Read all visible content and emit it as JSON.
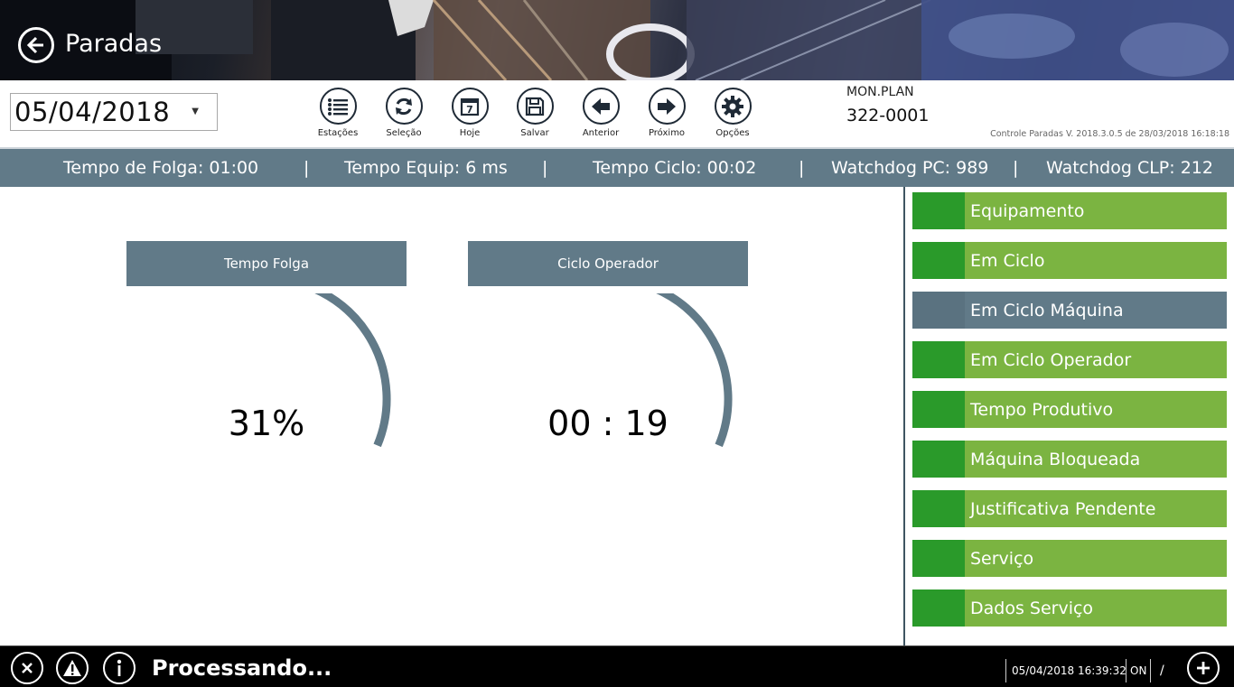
{
  "header": {
    "title": "Paradas",
    "back_icon": "arrow-left-icon"
  },
  "toolbar": {
    "date_value": "05/04/2018",
    "buttons": [
      {
        "label": "Estações",
        "icon": "list-icon"
      },
      {
        "label": "Seleção",
        "icon": "refresh-icon"
      },
      {
        "label": "Hoje",
        "icon": "calendar-icon"
      },
      {
        "label": "Salvar",
        "icon": "save-icon"
      },
      {
        "label": "Anterior",
        "icon": "arrow-left-icon"
      },
      {
        "label": "Próximo",
        "icon": "arrow-right-icon"
      },
      {
        "label": "Opções",
        "icon": "gear-icon"
      }
    ],
    "plan_label": "MON.PLAN",
    "plan_code": "322-0001",
    "version": "Controle Paradas V. 2018.3.0.5 de 28/03/2018 16:18:18"
  },
  "strip": {
    "items": [
      "Tempo de Folga: 01:00",
      "Tempo Equip: 6 ms",
      "Tempo Ciclo: 00:02",
      "Watchdog PC: 989",
      "Watchdog CLP: 212"
    ],
    "separator": "|"
  },
  "gauges": [
    {
      "title": "Tempo Folga",
      "value": "31%",
      "level": 0.31
    },
    {
      "title": "Ciclo Operador",
      "value": "00 : 19",
      "level": 0.31
    }
  ],
  "status_list": [
    {
      "label": "Equipamento",
      "state": "green"
    },
    {
      "label": "Em Ciclo",
      "state": "green"
    },
    {
      "label": "Em Ciclo Máquina",
      "state": "gray"
    },
    {
      "label": "Em Ciclo Operador",
      "state": "green"
    },
    {
      "label": "Tempo Produtivo",
      "state": "green"
    },
    {
      "label": "Máquina Bloqueada",
      "state": "green"
    },
    {
      "label": "Justificativa Pendente",
      "state": "green"
    },
    {
      "label": "Serviço",
      "state": "green"
    },
    {
      "label": "Dados Serviço",
      "state": "green"
    }
  ],
  "colors": {
    "green_swatch": "#2a9a2a",
    "green_bar": "#7bb441",
    "gray_swatch": "#5a7280",
    "gray_bar": "#617a88",
    "slate": "#617a88",
    "footer_bg": "#000000"
  },
  "footer": {
    "buttons": [
      {
        "icon": "close-icon"
      },
      {
        "icon": "warning-icon"
      },
      {
        "icon": "info-icon"
      }
    ],
    "status": "Processando...",
    "datetime": "05/04/2018 16:39:32",
    "mode": "ON",
    "slash": "/",
    "add_icon": "plus-icon"
  }
}
